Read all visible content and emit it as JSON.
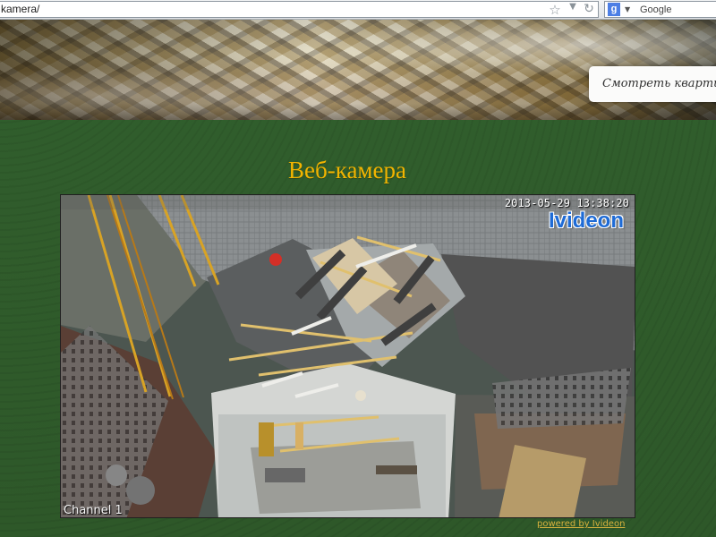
{
  "browser": {
    "address": "kamera/",
    "search_placeholder": "Google",
    "icons": [
      "star-icon",
      "dropdown-arrow-icon",
      "reload-icon",
      "google-icon"
    ]
  },
  "header": {
    "apartment_button_label": "Смотреть квартиры"
  },
  "main": {
    "title": "Веб-камера",
    "camera": {
      "timestamp": "2013-05-29 13:38:20",
      "logo_text": "Ivideon",
      "channel_label": "Channel 1"
    },
    "powered_link": "powered by Ivideon"
  },
  "colors": {
    "background_green": "#2f5a2b",
    "title_gold": "#f2b400",
    "link_gold": "#d7b13d",
    "ivideon_blue": "#1e6bd6"
  }
}
